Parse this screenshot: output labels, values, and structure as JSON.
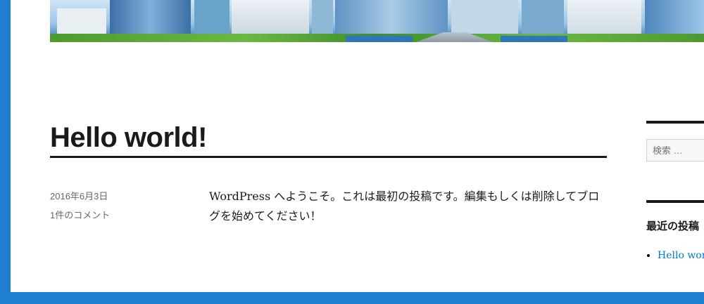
{
  "post": {
    "title": "Hello world!",
    "date": "2016年6月3日",
    "comments": "1件のコメント",
    "content": "WordPress へようこそ。これは最初の投稿です。編集もしくは削除してブログを始めてください！"
  },
  "sidebar": {
    "search_placeholder": "検索 …",
    "recent_posts_title": "最近の投稿",
    "recent_posts": [
      "Hello world!"
    ]
  },
  "colors": {
    "frame": "#1e7ed0",
    "link": "#007acc",
    "text": "#1a1a1a",
    "meta": "#686868"
  }
}
